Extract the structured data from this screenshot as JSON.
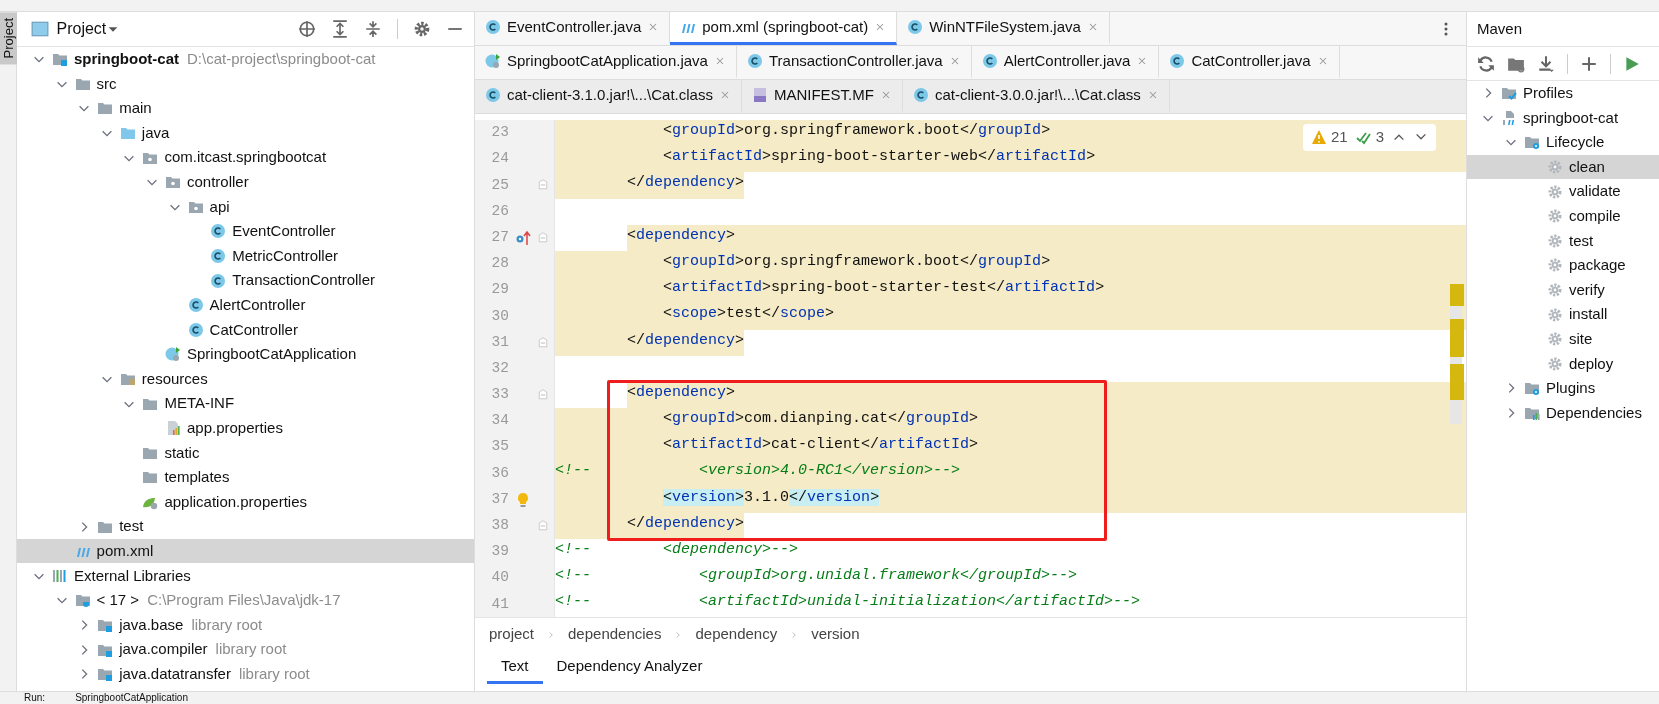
{
  "tool_strip": [
    {
      "label": "Project",
      "selected": true
    }
  ],
  "project_panel": {
    "title": "Project",
    "tree": [
      {
        "label": "springboot-cat",
        "hint": "D:\\cat-project\\springboot-cat",
        "kind": "module",
        "bold": true,
        "expanded": true,
        "selected": false,
        "children": [
          {
            "label": "src",
            "kind": "folder",
            "expanded": true,
            "selected": false,
            "children": [
              {
                "label": "main",
                "kind": "folder",
                "expanded": true,
                "selected": false,
                "children": [
                  {
                    "label": "java",
                    "kind": "source",
                    "expanded": true,
                    "selected": false,
                    "children": [
                      {
                        "label": "com.itcast.springbootcat",
                        "kind": "package",
                        "expanded": true,
                        "selected": false,
                        "children": [
                          {
                            "label": "controller",
                            "kind": "package",
                            "expanded": true,
                            "selected": false,
                            "children": [
                              {
                                "label": "api",
                                "kind": "package",
                                "expanded": true,
                                "selected": false,
                                "children": [
                                  {
                                    "label": "EventController",
                                    "kind": "class",
                                    "selected": false
                                  },
                                  {
                                    "label": "MetricController",
                                    "kind": "class",
                                    "selected": false
                                  },
                                  {
                                    "label": "TransactionController",
                                    "kind": "class",
                                    "selected": false
                                  }
                                ]
                              },
                              {
                                "label": "AlertController",
                                "kind": "class",
                                "selected": false
                              },
                              {
                                "label": "CatController",
                                "kind": "class",
                                "selected": false
                              }
                            ]
                          },
                          {
                            "label": "SpringbootCatApplication",
                            "kind": "application",
                            "selected": false
                          }
                        ]
                      }
                    ]
                  },
                  {
                    "label": "resources",
                    "kind": "resources",
                    "expanded": true,
                    "selected": false,
                    "children": [
                      {
                        "label": "META-INF",
                        "kind": "folder",
                        "expanded": true,
                        "selected": false,
                        "children": [
                          {
                            "label": "app.properties",
                            "kind": "properties",
                            "selected": false
                          }
                        ]
                      },
                      {
                        "label": "static",
                        "kind": "folder",
                        "selected": false
                      },
                      {
                        "label": "templates",
                        "kind": "folder",
                        "selected": false
                      },
                      {
                        "label": "application.properties",
                        "kind": "config",
                        "selected": false
                      }
                    ]
                  }
                ]
              },
              {
                "label": "test",
                "kind": "folder",
                "expanded": false,
                "selected": false
              }
            ]
          },
          {
            "label": "pom.xml",
            "kind": "maven",
            "selected": true
          }
        ]
      },
      {
        "label": "External Libraries",
        "kind": "libraries",
        "expanded": true,
        "selected": false,
        "children": [
          {
            "label": "< 17 >",
            "hint": "C:\\Program Files\\Java\\jdk-17",
            "kind": "jdk",
            "expanded": true,
            "selected": false,
            "children": [
              {
                "label": "java.base",
                "hint": "library root",
                "kind": "library",
                "expanded": false,
                "selected": false
              },
              {
                "label": "java.compiler",
                "hint": "library root",
                "kind": "library",
                "expanded": false,
                "selected": false
              },
              {
                "label": "java.datatransfer",
                "hint": "library root",
                "kind": "library",
                "expanded": false,
                "selected": false
              }
            ]
          }
        ]
      }
    ]
  },
  "editor": {
    "tab_rows": [
      {
        "tabs": [
          {
            "label": "EventController.java",
            "kind": "class",
            "selected": false
          },
          {
            "label": "pom.xml (springboot-cat)",
            "kind": "maven",
            "selected": true
          },
          {
            "label": "WinNTFileSystem.java",
            "kind": "class",
            "selected": false
          }
        ]
      },
      {
        "tabs": [
          {
            "label": "SpringbootCatApplication.java",
            "kind": "application",
            "selected": false
          },
          {
            "label": "TransactionController.java",
            "kind": "class",
            "selected": false
          },
          {
            "label": "AlertController.java",
            "kind": "class",
            "selected": false
          },
          {
            "label": "CatController.java",
            "kind": "class",
            "selected": false
          }
        ]
      },
      {
        "tabs": [
          {
            "label": "cat-client-3.1.0.jar!\\...\\Cat.class",
            "kind": "class",
            "selected": false
          },
          {
            "label": "MANIFEST.MF",
            "kind": "manifest",
            "selected": false
          },
          {
            "label": "cat-client-3.0.0.jar!\\...\\Cat.class",
            "kind": "class",
            "selected": false
          }
        ]
      }
    ],
    "inspections": {
      "warnings": "21",
      "checks": "3"
    },
    "lines": [
      {
        "number": "23",
        "kind": "code",
        "code": "            <groupId>org.springframework.boot</groupId>",
        "highlighted": true,
        "highlight_starts_at_text": false,
        "highlight_ends_at_text": false,
        "boxed": false
      },
      {
        "number": "24",
        "kind": "code",
        "code": "            <artifactId>spring-boot-starter-web</artifactId>",
        "highlighted": true,
        "highlight_starts_at_text": false,
        "highlight_ends_at_text": false,
        "boxed": false
      },
      {
        "number": "25",
        "kind": "code",
        "code": "        </dependency>",
        "highlighted": true,
        "highlight_starts_at_text": false,
        "highlight_ends_at_text": true,
        "fold": true,
        "boxed": false
      },
      {
        "number": "26",
        "kind": "code",
        "highlighted": false,
        "boxed": false
      },
      {
        "number": "27",
        "kind": "code",
        "code": "        <dependency>",
        "highlighted": true,
        "highlight_starts_at_text": true,
        "highlight_ends_at_text": false,
        "fold": true,
        "gutter": {
          "kind": "override"
        },
        "boxed": false
      },
      {
        "number": "28",
        "kind": "code",
        "code": "            <groupId>org.springframework.boot</groupId>",
        "highlighted": true,
        "highlight_starts_at_text": false,
        "highlight_ends_at_text": false,
        "boxed": false
      },
      {
        "number": "29",
        "kind": "code",
        "code": "            <artifactId>spring-boot-starter-test</artifactId>",
        "highlighted": true,
        "highlight_starts_at_text": false,
        "highlight_ends_at_text": false,
        "boxed": false
      },
      {
        "number": "30",
        "kind": "code",
        "code": "            <scope>test</scope>",
        "highlighted": true,
        "highlight_starts_at_text": false,
        "highlight_ends_at_text": false,
        "boxed": false
      },
      {
        "number": "31",
        "kind": "code",
        "code": "        </dependency>",
        "highlighted": true,
        "highlight_starts_at_text": false,
        "highlight_ends_at_text": true,
        "fold": true,
        "boxed": false
      },
      {
        "number": "32",
        "kind": "code",
        "highlighted": false,
        "boxed": false
      },
      {
        "number": "33",
        "kind": "code",
        "code": "        <dependency>",
        "highlighted": true,
        "highlight_starts_at_text": true,
        "highlight_ends_at_text": false,
        "fold": true,
        "boxed": true
      },
      {
        "number": "34",
        "kind": "code",
        "code": "            <groupId>com.dianping.cat</groupId>",
        "highlighted": true,
        "highlight_starts_at_text": false,
        "highlight_ends_at_text": false,
        "boxed": true
      },
      {
        "number": "35",
        "kind": "code",
        "code": "            <artifactId>cat-client</artifactId>",
        "highlighted": true,
        "highlight_starts_at_text": false,
        "highlight_ends_at_text": false,
        "boxed": true
      },
      {
        "number": "36",
        "kind": "comment",
        "code": "<!--            <version>4.0-RC1</version>-->",
        "highlighted": true,
        "highlight_ends_at_text": false,
        "boxed": true
      },
      {
        "number": "37",
        "kind": "code",
        "code": "            <version>3.1.0</version>",
        "highlighted": true,
        "highlight_starts_at_text": false,
        "highlight_ends_at_text": false,
        "gutter": {
          "kind": "bulb"
        },
        "match": true,
        "boxed": true
      },
      {
        "number": "38",
        "kind": "code",
        "code": "        </dependency>",
        "highlighted": true,
        "highlight_starts_at_text": false,
        "highlight_ends_at_text": true,
        "fold": true,
        "boxed": true
      },
      {
        "number": "39",
        "kind": "comment",
        "code": "<!--        <dependency>-->",
        "highlighted": false,
        "boxed": false
      },
      {
        "number": "40",
        "kind": "comment",
        "code": "<!--            <groupId>org.unidal.framework</groupId>-->",
        "highlighted": false,
        "boxed": false
      },
      {
        "number": "41",
        "kind": "comment",
        "code": "<!--            <artifactId>unidal-initialization</artifactId>-->",
        "highlighted": false,
        "boxed": false
      }
    ],
    "breadcrumbs": [
      "project",
      "dependencies",
      "dependency",
      "version"
    ],
    "bottom_tabs": [
      {
        "label": "Text",
        "selected": true
      },
      {
        "label": "Dependency Analyzer",
        "selected": false
      }
    ]
  },
  "maven_panel": {
    "title": "Maven",
    "tree": [
      {
        "label": "Profiles",
        "kind": "profiles",
        "expanded": false,
        "selected": false
      },
      {
        "label": "springboot-cat",
        "kind": "maven-module",
        "expanded": true,
        "selected": false,
        "children": [
          {
            "label": "Lifecycle",
            "kind": "gear-folder",
            "expanded": true,
            "selected": false,
            "children": [
              {
                "label": "clean",
                "kind": "gear",
                "selected": true
              },
              {
                "label": "validate",
                "kind": "gear",
                "selected": false
              },
              {
                "label": "compile",
                "kind": "gear",
                "selected": false
              },
              {
                "label": "test",
                "kind": "gear",
                "selected": false
              },
              {
                "label": "package",
                "kind": "gear",
                "selected": false
              },
              {
                "label": "verify",
                "kind": "gear",
                "selected": false
              },
              {
                "label": "install",
                "kind": "gear",
                "selected": false
              },
              {
                "label": "site",
                "kind": "gear",
                "selected": false
              },
              {
                "label": "deploy",
                "kind": "gear",
                "selected": false
              }
            ]
          },
          {
            "label": "Plugins",
            "kind": "gear-folder",
            "expanded": false,
            "selected": false
          },
          {
            "label": "Dependencies",
            "kind": "deps-folder",
            "expanded": false,
            "selected": false
          }
        ]
      }
    ]
  },
  "run_bar": {
    "label": "Run:",
    "config": "SpringbootCatApplication"
  }
}
